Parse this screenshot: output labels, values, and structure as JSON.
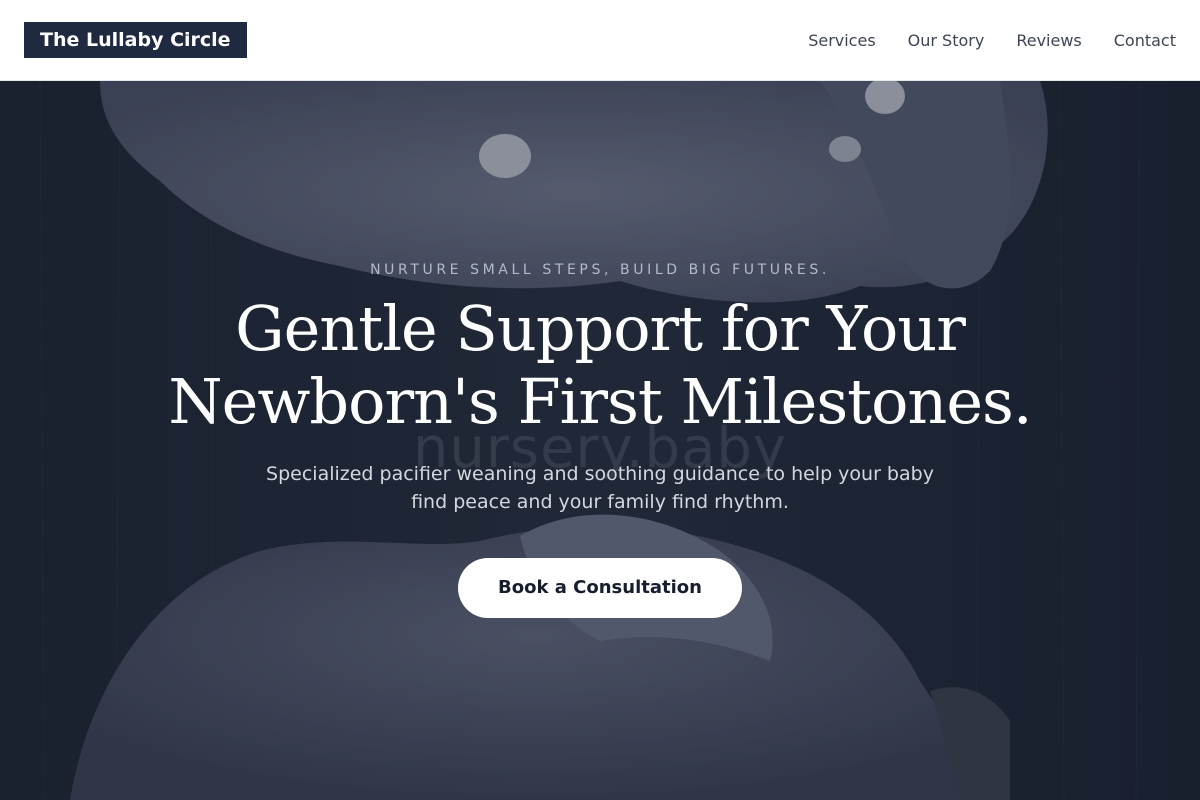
{
  "header": {
    "brand": "The Lullaby Circle",
    "nav": [
      {
        "label": "Services"
      },
      {
        "label": "Our Story"
      },
      {
        "label": "Reviews"
      },
      {
        "label": "Contact"
      }
    ]
  },
  "hero": {
    "eyebrow": "NURTURE SMALL STEPS, BUILD BIG FUTURES.",
    "headline_line1": "Gentle Support for Your",
    "headline_line2": "Newborn's First Milestones.",
    "subhead": "Specialized pacifier weaning and soothing guidance to help your baby find peace and your family find rhythm.",
    "cta_label": "Book a Consultation",
    "watermark": "nursery.baby"
  },
  "colors": {
    "brand_bg": "#1f2a40",
    "hero_bg": "#1b2230",
    "cta_bg": "#ffffff",
    "cta_text": "#161d2d",
    "nav_text": "#3d4554"
  }
}
